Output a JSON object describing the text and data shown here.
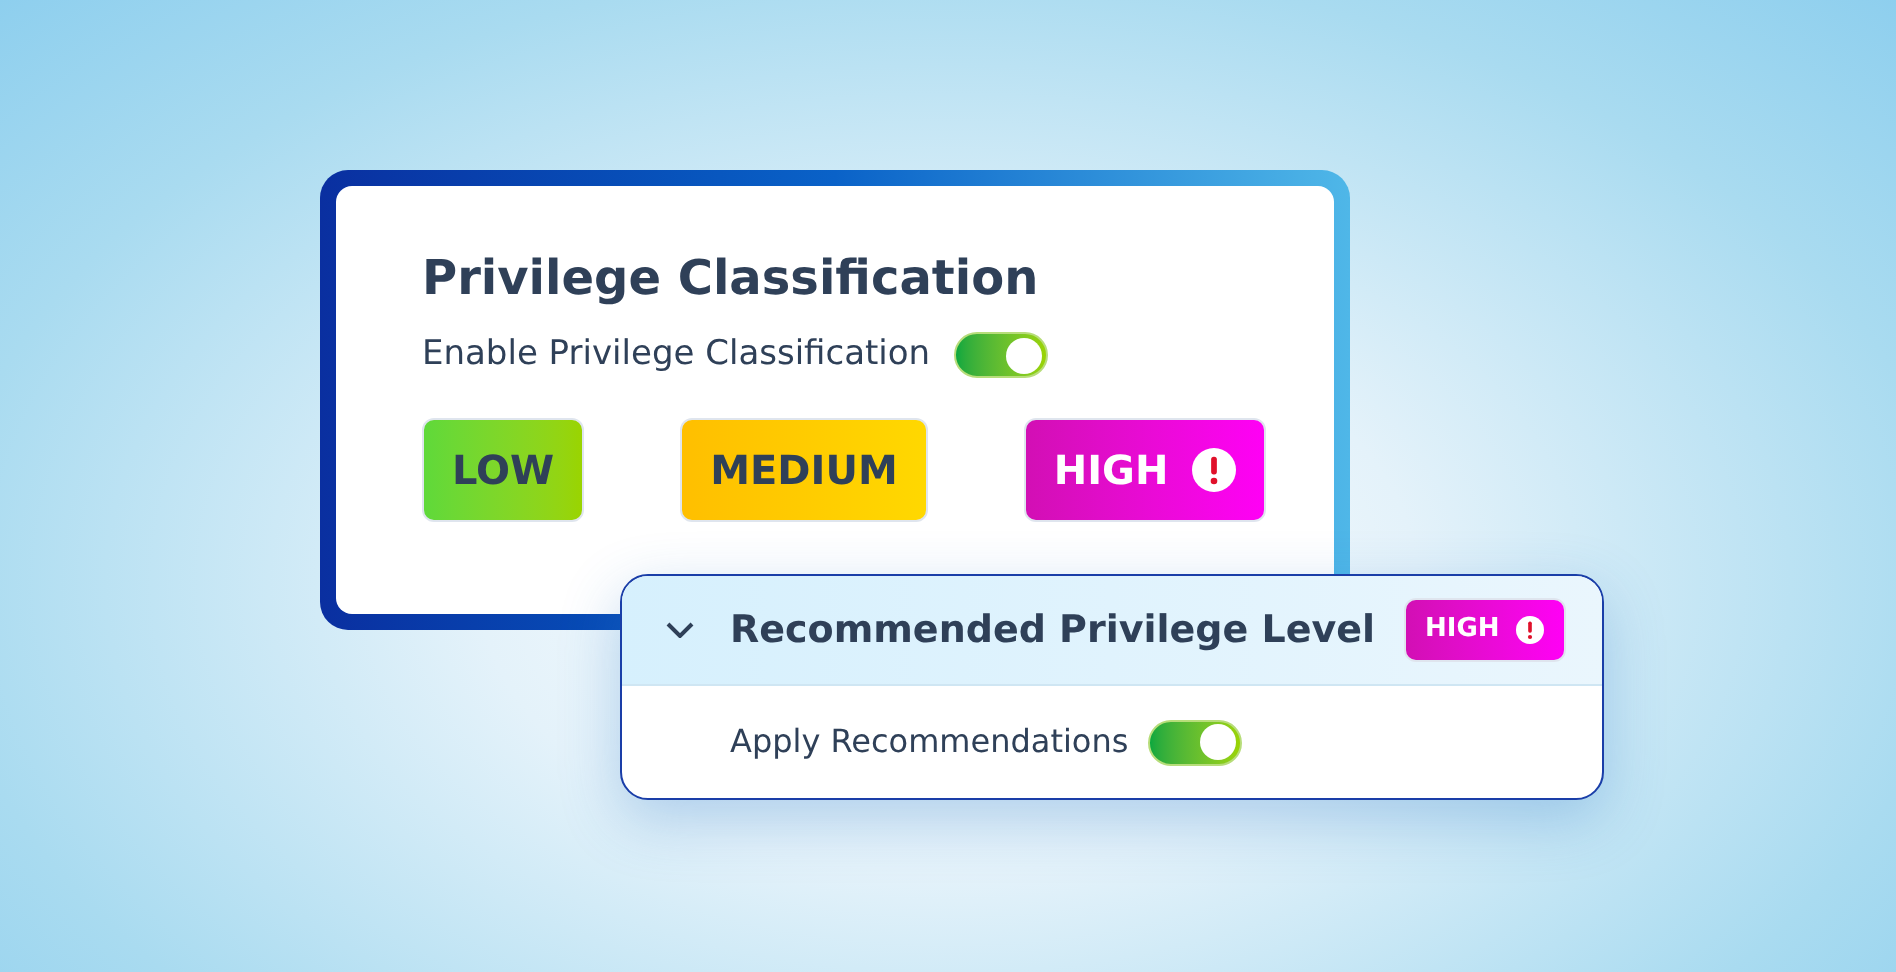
{
  "classification_card": {
    "title": "Privilege Classification",
    "enable_toggle": {
      "label": "Enable Privilege Classification",
      "on": true
    },
    "levels": [
      {
        "kind": "low",
        "label": "LOW",
        "alert": false
      },
      {
        "kind": "medium",
        "label": "MEDIUM",
        "alert": false
      },
      {
        "kind": "high",
        "label": "HIGH",
        "alert": true
      }
    ]
  },
  "recommendation_panel": {
    "title": "Recommended Privilege Level",
    "expanded": true,
    "badge": {
      "kind": "high",
      "label": "HIGH",
      "alert": true
    },
    "apply_toggle": {
      "label": "Apply Recommendations",
      "on": true
    }
  }
}
